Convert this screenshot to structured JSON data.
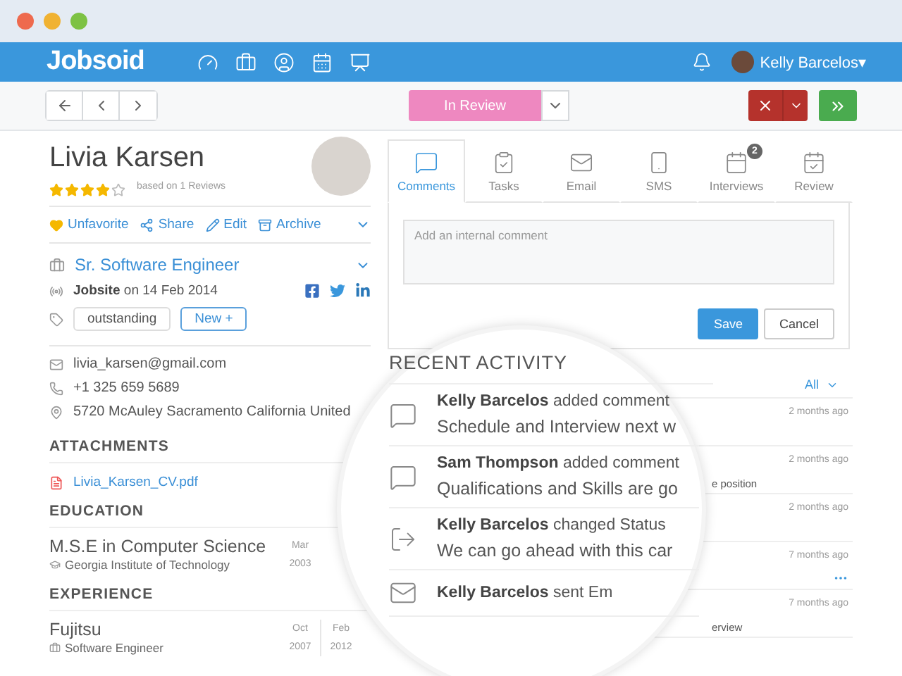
{
  "navbar": {
    "logo": "Jobsoid",
    "user": "Kelly Barcelos▾"
  },
  "toolbar": {
    "status": "In Review"
  },
  "candidate": {
    "name": "Livia Karsen",
    "stars": 4,
    "reviews": "based on 1 Reviews",
    "actions": [
      {
        "kind": "favorite",
        "label": "Unfavorite"
      },
      {
        "kind": "share",
        "label": "Share"
      },
      {
        "kind": "edit",
        "label": "Edit"
      },
      {
        "kind": "archive",
        "label": "Archive"
      }
    ],
    "job": "Sr. Software Engineer",
    "source": "Jobsite",
    "source_date": "on 14 Feb 2014",
    "tags": [
      {
        "label": "outstanding",
        "kind": "tag"
      },
      {
        "label": "New +",
        "kind": "add"
      }
    ],
    "contacts": [
      {
        "kind": "email",
        "text": "livia_karsen@gmail.com"
      },
      {
        "kind": "phone",
        "text": "+1 325 659 5689"
      },
      {
        "kind": "address",
        "text": "5720 McAuley Sacramento California United"
      }
    ]
  },
  "attachments": {
    "title": "ATTACHMENTS",
    "files": [
      "Livia_Karsen_CV.pdf"
    ]
  },
  "education": {
    "title": "EDUCATION",
    "items": [
      {
        "title": "M.S.E in Computer Science",
        "subtitle": "Georgia Institute of Technology",
        "dates": [
          [
            "Mar",
            "2003"
          ]
        ]
      }
    ]
  },
  "experience": {
    "title": "EXPERIENCE",
    "items": [
      {
        "title": "Fujitsu",
        "subtitle": "Software Engineer",
        "dates": [
          [
            "Oct",
            "2007"
          ],
          [
            "Feb",
            "2012"
          ]
        ]
      }
    ]
  },
  "tabs": [
    {
      "kind": "comments",
      "label": "Comments",
      "selected": true
    },
    {
      "kind": "tasks",
      "label": "Tasks",
      "selected": false
    },
    {
      "kind": "email",
      "label": "Email",
      "selected": false
    },
    {
      "kind": "sms",
      "label": "SMS",
      "selected": false
    },
    {
      "kind": "interviews",
      "label": "Interviews",
      "selected": false,
      "badge": "2"
    },
    {
      "kind": "review",
      "label": "Review",
      "selected": false
    }
  ],
  "comment_box": {
    "placeholder": "Add an internal comment",
    "buttons": [
      "Save",
      "Cancel"
    ]
  },
  "activity": {
    "title": "RECENT ACTIVITY",
    "filter": "All",
    "magnified": [
      {
        "kind": "comment",
        "author": "Kelly Barcelos",
        "action": "added comment",
        "text": "Schedule and Interview next w"
      },
      {
        "kind": "comment",
        "author": "Sam Thompson",
        "action": "added comment",
        "text": "Qualifications and Skills are go"
      },
      {
        "kind": "status",
        "author": "Kelly Barcelos",
        "action": "changed Status",
        "text": "We can go ahead with this car"
      },
      {
        "kind": "email",
        "author": "Kelly Barcelos",
        "action": "sent Em"
      }
    ],
    "rows": [
      {
        "time": "2 months ago",
        "more": false
      },
      {
        "time": "2 months ago",
        "fragment": "e position",
        "more": false
      },
      {
        "time": "2 months ago",
        "more": false
      },
      {
        "time": "7 months ago",
        "more": true
      },
      {
        "time": "7 months ago",
        "fragment": "erview",
        "more": false
      }
    ]
  }
}
